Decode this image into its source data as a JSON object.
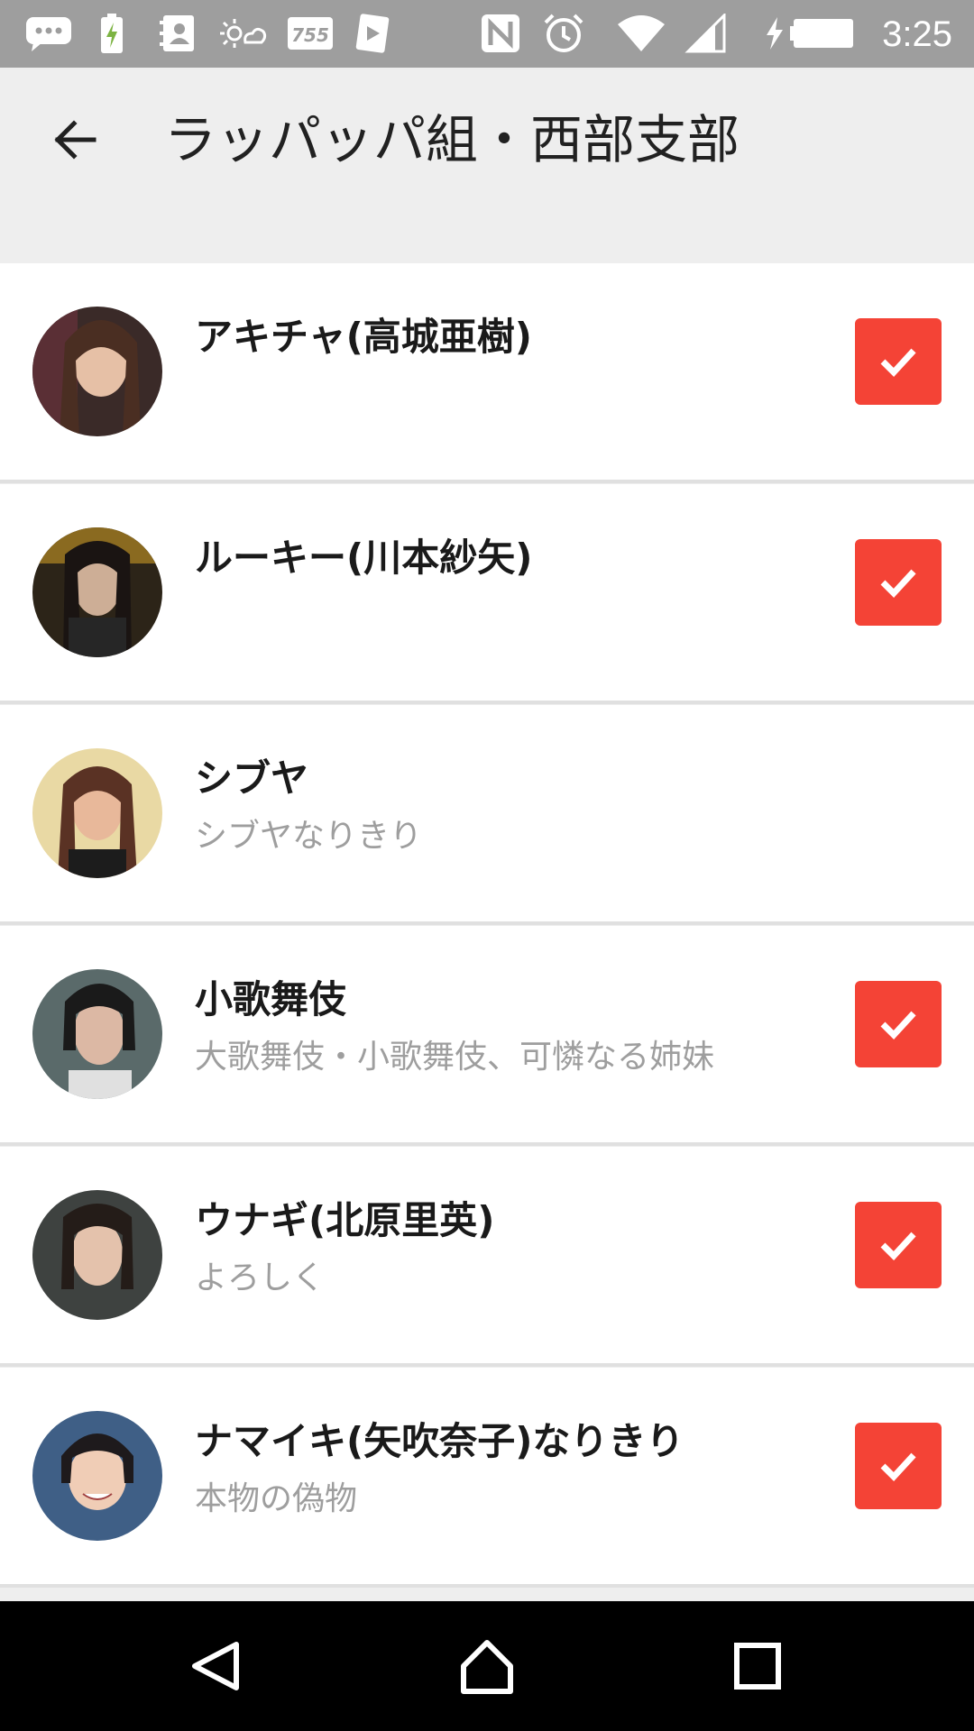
{
  "status_bar": {
    "time": "3:25",
    "icons": [
      "message-icon",
      "battery-saver-icon",
      "contacts-icon",
      "weather-icon",
      "app-755-icon",
      "card-icon",
      "nfc-icon",
      "alarm-icon",
      "wifi-icon",
      "signal-icon",
      "battery-charging-icon"
    ],
    "app_badge_text": "755"
  },
  "app_bar": {
    "back_icon": "arrow-back-icon",
    "title": "ラッパッパ組・西部支部"
  },
  "colors": {
    "accent": "#f44336",
    "status_bar": "#9e9e9e",
    "app_bar": "#eeeeee",
    "nav_bar": "#000000"
  },
  "members": [
    {
      "name": "アキチャ(高城亜樹)",
      "status": "",
      "checked": true
    },
    {
      "name": "ルーキー(川本紗矢)",
      "status": "",
      "checked": true
    },
    {
      "name": "シブヤ",
      "status": "シブヤなりきり",
      "checked": false
    },
    {
      "name": "小歌舞伎",
      "status": "大歌舞伎・小歌舞伎、可憐なる姉妹",
      "checked": true
    },
    {
      "name": "ウナギ(北原里英)",
      "status": "よろしく",
      "checked": true
    },
    {
      "name": "ナマイキ(矢吹奈子)なりきり",
      "status": "本物の偽物",
      "checked": true
    }
  ],
  "nav_bar": {
    "back_icon": "nav-back-icon",
    "home_icon": "nav-home-icon",
    "recents_icon": "nav-recents-icon"
  }
}
